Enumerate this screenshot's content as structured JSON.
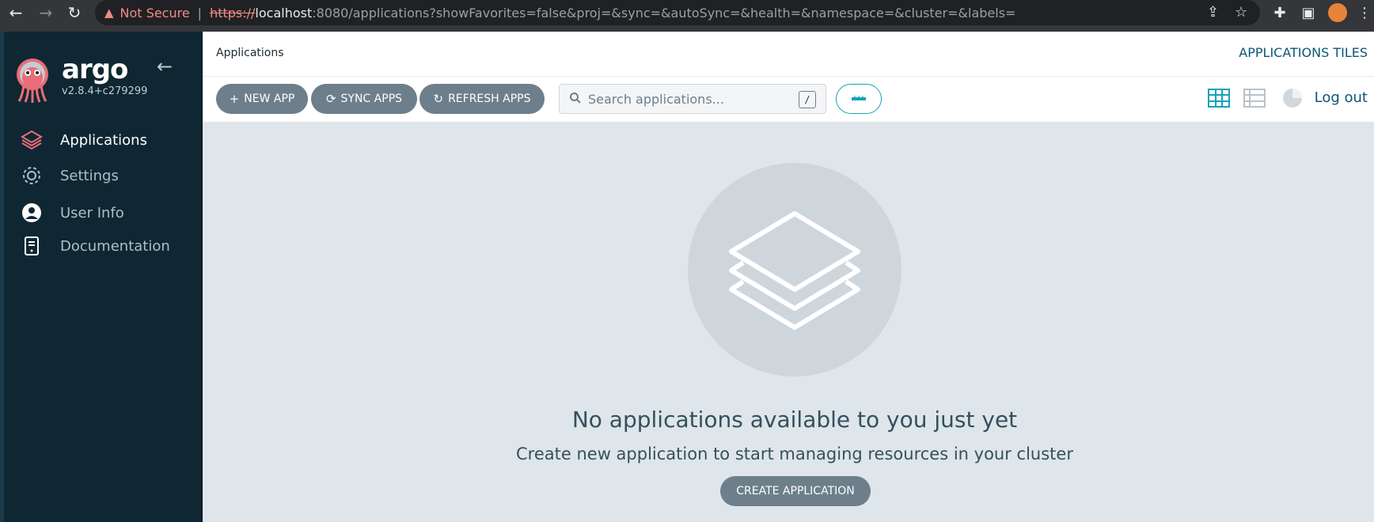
{
  "browser": {
    "security_label": "Not Secure",
    "url_scheme": "https://",
    "url_host": "localhost",
    "url_path": ":8080/applications?showFavorites=false&proj=&sync=&autoSync=&health=&namespace=&cluster=&labels="
  },
  "sidebar": {
    "brand": "argo",
    "version": "v2.8.4+c279299",
    "items": [
      {
        "label": "Applications",
        "icon": "layers-icon",
        "active": true
      },
      {
        "label": "Settings",
        "icon": "gear-icon",
        "active": false
      },
      {
        "label": "User Info",
        "icon": "user-icon",
        "active": false
      },
      {
        "label": "Documentation",
        "icon": "book-icon",
        "active": false
      }
    ]
  },
  "header": {
    "breadcrumb": "Applications",
    "view_title": "APPLICATIONS TILES"
  },
  "toolbar": {
    "new_app": "NEW APP",
    "sync_apps": "SYNC APPS",
    "refresh_apps": "REFRESH APPS",
    "search_placeholder": "Search applications...",
    "search_shortcut": "/",
    "logout": "Log out"
  },
  "empty_state": {
    "title": "No applications available to you just yet",
    "subtitle": "Create new application to start managing resources in your cluster",
    "button": "CREATE APPLICATION"
  },
  "colors": {
    "sidebar_bg": "#0f2733",
    "accent": "#17a2b8",
    "link": "#0c5675",
    "button": "#6d7f8b",
    "main_bg": "#dee6eb",
    "active_icon": "#e96d76"
  }
}
